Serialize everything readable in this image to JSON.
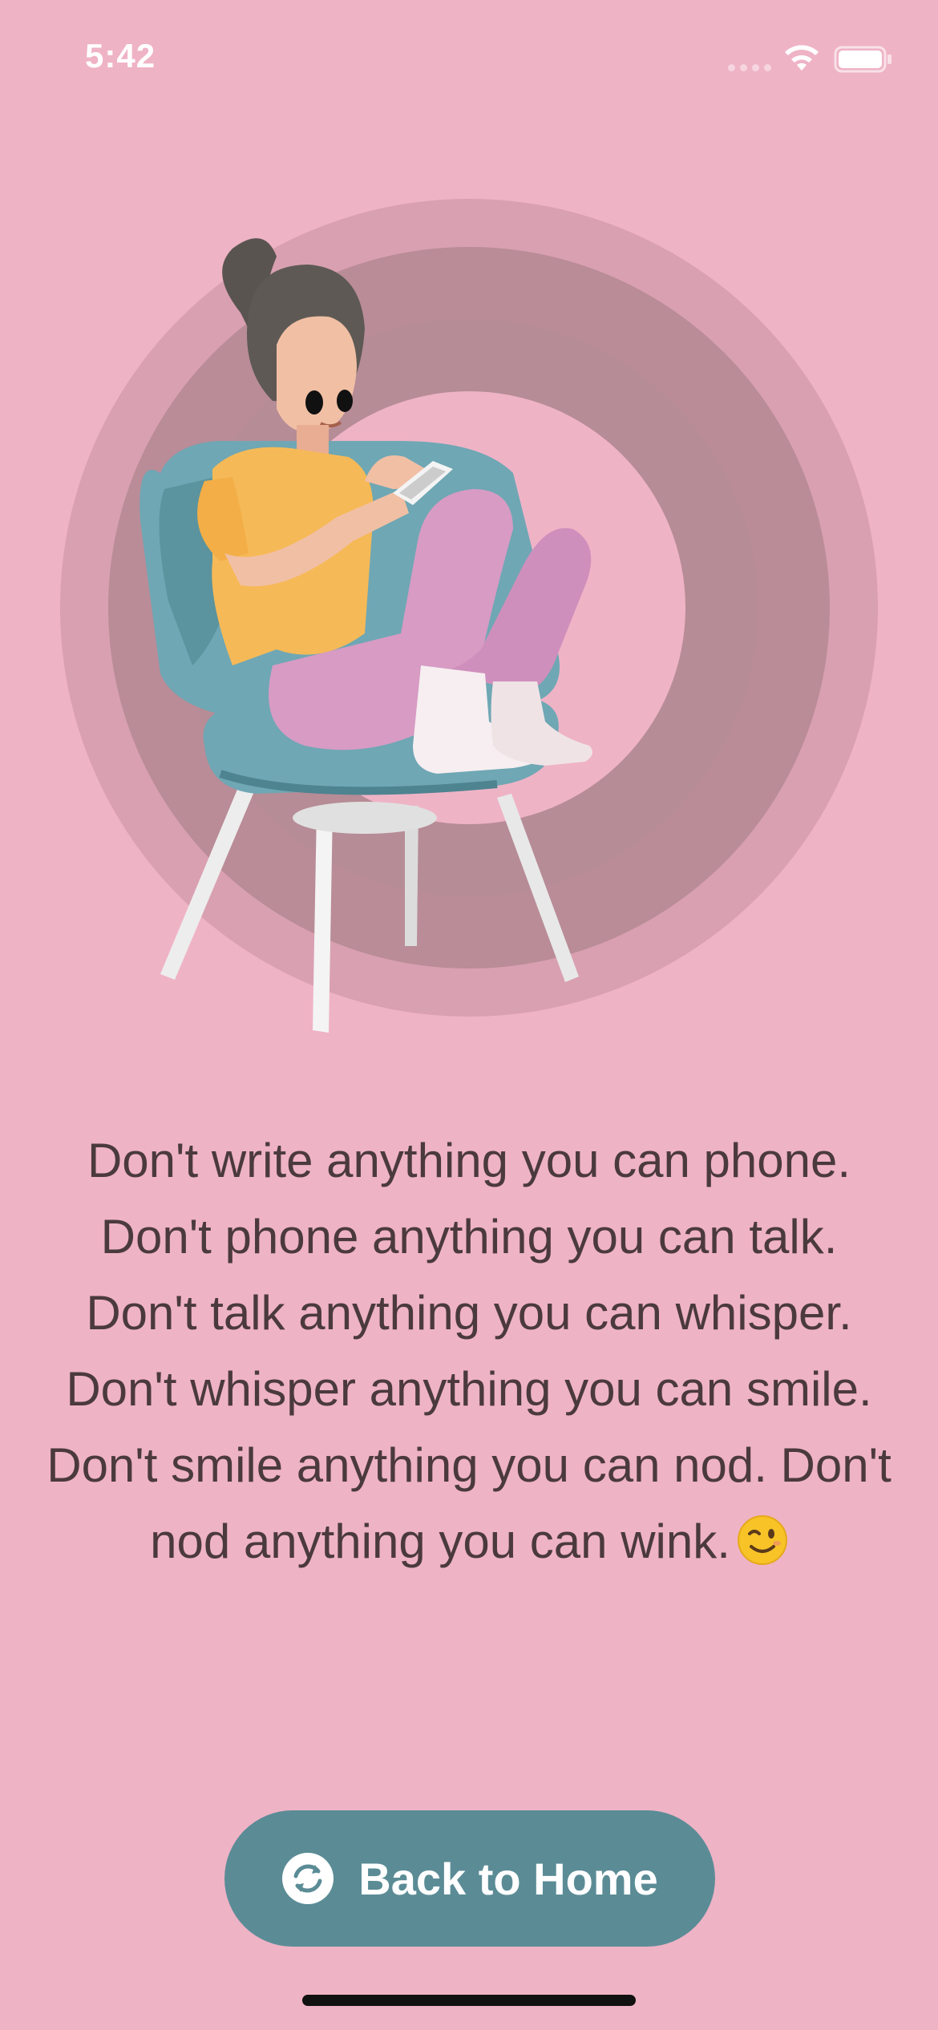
{
  "status_bar": {
    "time": "5:42",
    "icons": [
      "signal-dots-icon",
      "wifi-icon",
      "battery-icon"
    ]
  },
  "illustration": {
    "subject": "person-sitting-on-chair-using-phone",
    "icons": [
      "concentric-rings",
      "chair",
      "person",
      "phone"
    ]
  },
  "message": {
    "text": "Don't write anything you can phone. Don't phone anything you can talk. Don't talk anything you can whisper. Don't whisper anything you can smile. Don't smile anything you can nod. Don't nod anything you can wink.",
    "emoji_icon": "winking-face-emoji"
  },
  "actions": {
    "home_button_label": "Back to Home",
    "home_button_icon": "refresh-circle-icon"
  },
  "colors": {
    "background": "#EFB3C6",
    "ring_outer": "#D9A0B1",
    "ring_mid": "#B98C97",
    "button": "#5B8C96",
    "text": "#4B3A3D"
  }
}
